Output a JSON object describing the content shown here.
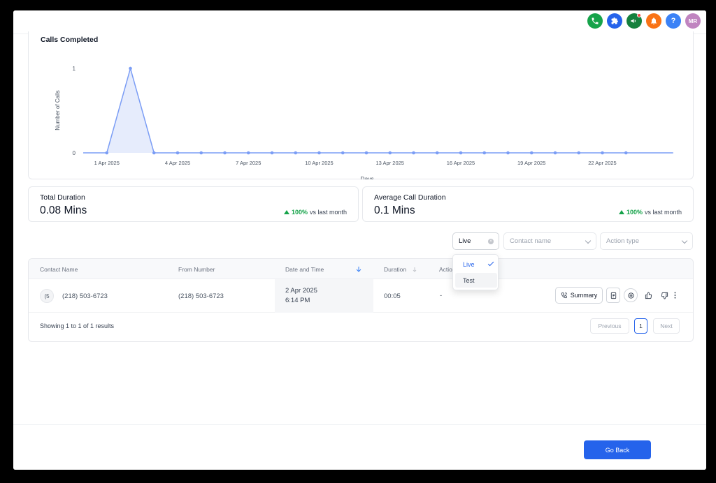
{
  "header": {
    "icons": [
      {
        "name": "phone-icon",
        "color": "#16a34a"
      },
      {
        "name": "puzzle-icon",
        "color": "#2563eb"
      },
      {
        "name": "megaphone-icon",
        "color": "#15803d",
        "badge": true
      },
      {
        "name": "bell-icon",
        "color": "#f97316"
      },
      {
        "name": "help-icon",
        "color": "#3b82f6",
        "glyph": "?"
      }
    ],
    "avatar_initials": "MR",
    "avatar_color": "#c084c0"
  },
  "chart_data": {
    "type": "line",
    "title": "Calls Completed",
    "xlabel": "Days",
    "ylabel": "Number of Calls",
    "ylim": [
      0,
      1
    ],
    "y_ticks": [
      "0",
      "1"
    ],
    "x_tick_labels": [
      "1 Apr 2025",
      "4 Apr 2025",
      "7 Apr 2025",
      "10 Apr 2025",
      "13 Apr 2025",
      "16 Apr 2025",
      "19 Apr 2025",
      "22 Apr 2025"
    ],
    "x": [
      "31 Mar 2025",
      "1 Apr 2025",
      "2 Apr 2025",
      "3 Apr 2025",
      "4 Apr 2025",
      "5 Apr 2025",
      "6 Apr 2025",
      "7 Apr 2025",
      "8 Apr 2025",
      "9 Apr 2025",
      "10 Apr 2025",
      "11 Apr 2025",
      "12 Apr 2025",
      "13 Apr 2025",
      "14 Apr 2025",
      "15 Apr 2025",
      "16 Apr 2025",
      "17 Apr 2025",
      "18 Apr 2025",
      "19 Apr 2025",
      "20 Apr 2025",
      "21 Apr 2025",
      "22 Apr 2025",
      "23 Apr 2025",
      "24 Apr 2025",
      "25 Apr 2025"
    ],
    "series": [
      {
        "values": [
          0,
          0,
          1,
          0,
          0,
          0,
          0,
          0,
          0,
          0,
          0,
          0,
          0,
          0,
          0,
          0,
          0,
          0,
          0,
          0,
          0,
          0,
          0,
          0,
          0,
          0
        ]
      }
    ],
    "line_color": "#7b9df5",
    "marker_indices": [
      1,
      2,
      3,
      4,
      5,
      6,
      7,
      8,
      9,
      10,
      11,
      12,
      13,
      14,
      15,
      16,
      17,
      18,
      19,
      20,
      21,
      22,
      23
    ]
  },
  "stats": [
    {
      "label": "Total Duration",
      "value": "0.08 Mins",
      "change": "100%",
      "change_suffix": "vs last month"
    },
    {
      "label": "Average Call Duration",
      "value": "0.1 Mins",
      "change": "100%",
      "change_suffix": "vs last month"
    }
  ],
  "filters": {
    "mode_value": "Live",
    "contact_placeholder": "Contact name",
    "action_placeholder": "Action type",
    "mode_options": [
      {
        "label": "Live",
        "selected": true
      },
      {
        "label": "Test",
        "selected": false
      }
    ]
  },
  "table": {
    "headers": {
      "contact": "Contact Name",
      "from": "From Number",
      "date": "Date and Time",
      "duration": "Duration",
      "action": "Actio"
    },
    "rows": [
      {
        "avatar": "(5",
        "contact": "(218) 503-6723",
        "from": "(218) 503-6723",
        "date": "2 Apr 2025",
        "time": "6:14 PM",
        "duration": "00:05",
        "action": "-",
        "summary_label": "Summary"
      }
    ],
    "footer_text": "Showing 1 to 1 of 1 results",
    "pagination": {
      "prev": "Previous",
      "current": "1",
      "next": "Next"
    }
  },
  "footer": {
    "go_back": "Go Back",
    "accent": "#2563eb"
  }
}
